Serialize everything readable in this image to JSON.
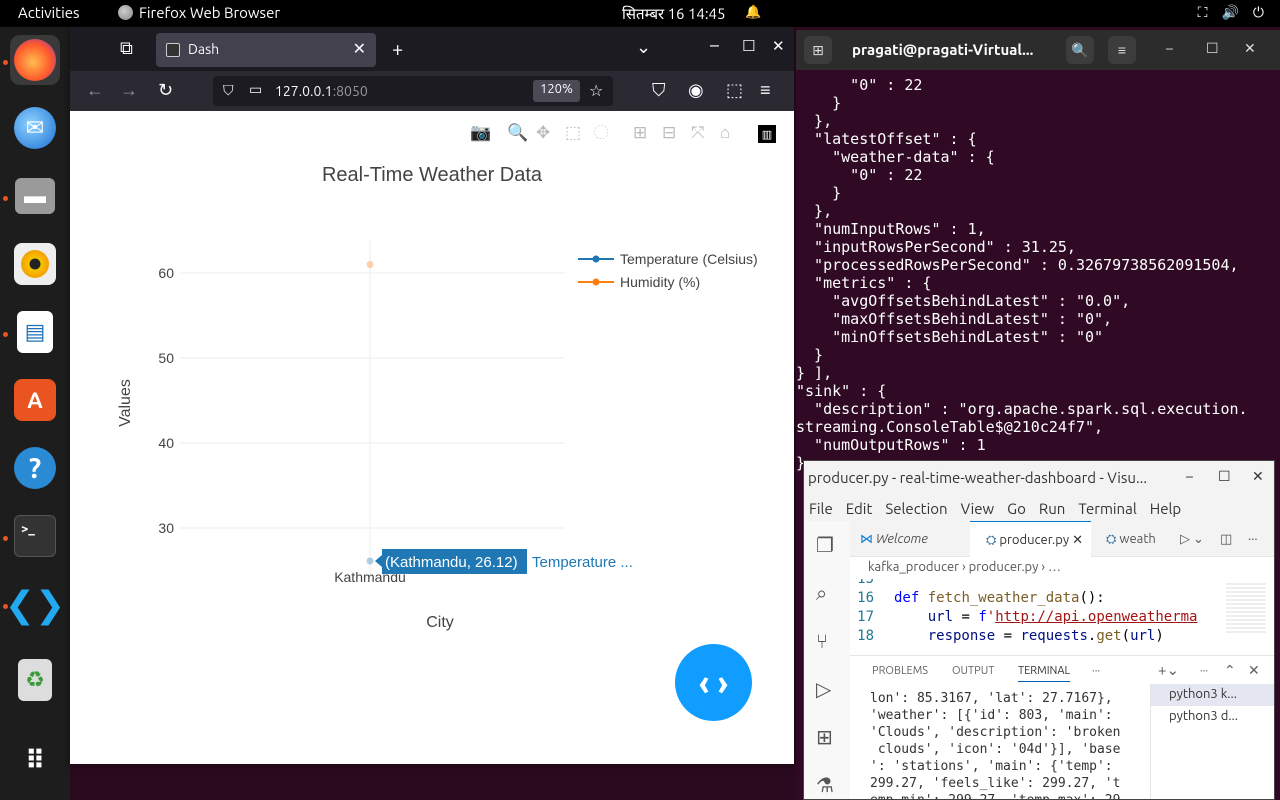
{
  "topbar": {
    "activities": "Activities",
    "app_name": "Firefox Web Browser",
    "datetime": "सितम्बर 16  14:45"
  },
  "dock": {
    "items": [
      "firefox",
      "thunderbird",
      "files",
      "rhythmbox",
      "libreoffice-impress",
      "app-center",
      "help",
      "terminal",
      "vscode",
      "trash",
      "show-apps"
    ]
  },
  "browser": {
    "tab_title": "Dash",
    "url_host": "127.0.0.1",
    "url_port": ":8050",
    "zoom": "120%"
  },
  "chart_data": {
    "type": "scatter",
    "title": "Real-Time Weather Data",
    "xlabel": "City",
    "ylabel": "Values",
    "categories": [
      "Kathmandu"
    ],
    "series": [
      {
        "name": "Temperature (Celsius)",
        "values": [
          26.12
        ],
        "color": "#1f77b4"
      },
      {
        "name": "Humidity (%)",
        "values": [
          61
        ],
        "color": "#ff7f0e"
      }
    ],
    "yticks": [
      30,
      40,
      50,
      60
    ],
    "ylim": [
      24,
      64
    ],
    "hover_label": "(Kathmandu, 26.12)",
    "hover_series": "Temperature ...",
    "legend": "top-right"
  },
  "terminal": {
    "title": "pragati@pragati-Virtual...",
    "lines": [
      "      \"0\" : 22",
      "    }",
      "  },",
      "  \"latestOffset\" : {",
      "    \"weather-data\" : {",
      "      \"0\" : 22",
      "    }",
      "  },",
      "  \"numInputRows\" : 1,",
      "  \"inputRowsPerSecond\" : 31.25,",
      "  \"processedRowsPerSecond\" : 0.32679738562091504,",
      "  \"metrics\" : {",
      "    \"avgOffsetsBehindLatest\" : \"0.0\",",
      "    \"maxOffsetsBehindLatest\" : \"0\",",
      "    \"minOffsetsBehindLatest\" : \"0\"",
      "  }",
      "} ],",
      "\"sink\" : {",
      "  \"description\" : \"org.apache.spark.sql.execution.",
      "streaming.ConsoleTable$@210c24f7\",",
      "  \"numOutputRows\" : 1",
      "}"
    ]
  },
  "vscode": {
    "title": "producer.py - real-time-weather-dashboard - Visu...",
    "menu": [
      "File",
      "Edit",
      "Selection",
      "View",
      "Go",
      "Run",
      "Terminal",
      "Help"
    ],
    "tabs": [
      "Welcome",
      "producer.py",
      "weath"
    ],
    "breadcrumb": "kafka_producer  ›  producer.py  › …",
    "code": [
      {
        "ln": "15",
        "text": ""
      },
      {
        "ln": "16",
        "text": "def fetch_weather_data():"
      },
      {
        "ln": "17",
        "text": "    url = f'http://api.openweatherma"
      },
      {
        "ln": "18",
        "text": "    response = requests.get(url)"
      }
    ],
    "panel_tabs": [
      "PROBLEMS",
      "OUTPUT",
      "TERMINAL",
      "···"
    ],
    "terminal_output": [
      "lon': 85.3167, 'lat': 27.7167},",
      "'weather': [{'id': 803, 'main':",
      "'Clouds', 'description': 'broken",
      " clouds', 'icon': '04d'}], 'base",
      "': 'stations', 'main': {'temp':",
      "299.27, 'feels_like': 299.27, 't",
      "emp_min': 299.27, 'temp_max': 29"
    ],
    "terminal_list": [
      "python3 k...",
      "python3 d..."
    ]
  }
}
